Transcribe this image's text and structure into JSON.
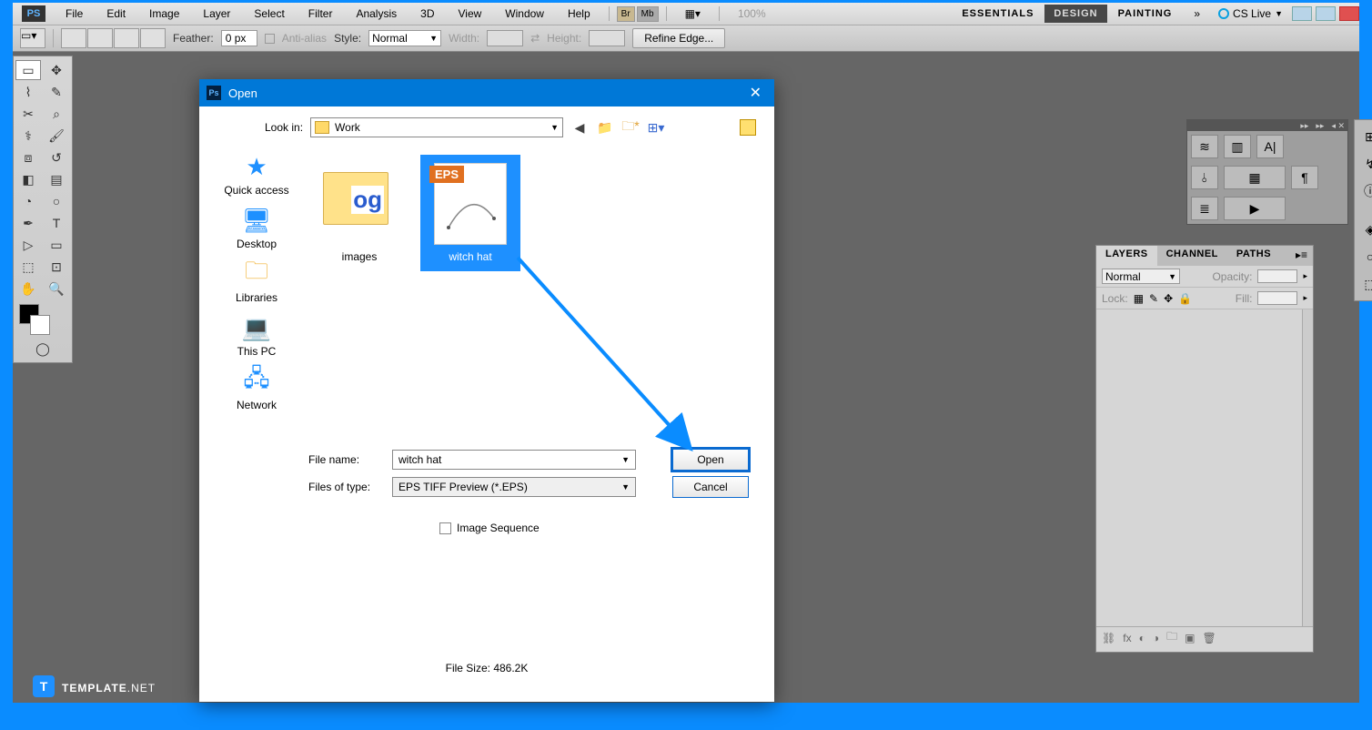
{
  "menubar": {
    "logo": "PS",
    "items": [
      "File",
      "Edit",
      "Image",
      "Layer",
      "Select",
      "Filter",
      "Analysis",
      "3D",
      "View",
      "Window",
      "Help"
    ],
    "zoom": "100%",
    "workspaces": [
      "ESSENTIALS",
      "DESIGN",
      "PAINTING"
    ],
    "activeWs": 1,
    "cslive": "CS Live"
  },
  "optionsbar": {
    "feather_lbl": "Feather:",
    "feather_val": "0 px",
    "antialias": "Anti-alias",
    "style_lbl": "Style:",
    "style_val": "Normal",
    "width_lbl": "Width:",
    "height_lbl": "Height:",
    "refine": "Refine Edge..."
  },
  "layers": {
    "tabs": [
      "LAYERS",
      "CHANNEL",
      "PATHS"
    ],
    "blend": "Normal",
    "opacity_lbl": "Opacity:",
    "lock_lbl": "Lock:",
    "fill_lbl": "Fill:"
  },
  "dialog": {
    "title": "Open",
    "lookin_lbl": "Look in:",
    "lookin_val": "Work",
    "places": [
      "Quick access",
      "Desktop",
      "Libraries",
      "This PC",
      "Network"
    ],
    "files": [
      {
        "name": "images",
        "type": "folder"
      },
      {
        "name": "witch hat",
        "type": "eps",
        "selected": true
      }
    ],
    "filename_lbl": "File name:",
    "filename_val": "witch hat",
    "filetype_lbl": "Files of type:",
    "filetype_val": "EPS TIFF Preview (*.EPS)",
    "open_btn": "Open",
    "cancel_btn": "Cancel",
    "imgseq": "Image Sequence",
    "filesize_lbl": "File Size:",
    "filesize_val": "486.2K"
  },
  "watermark": {
    "brand": "TEMPLATE",
    "suffix": ".NET",
    "icon": "T"
  }
}
